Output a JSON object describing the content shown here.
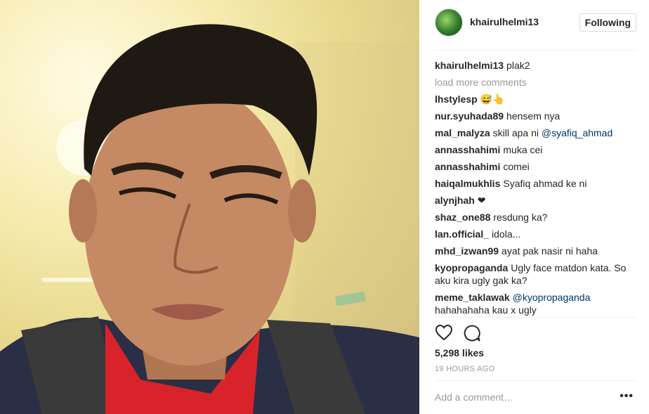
{
  "photo": {
    "alt_subject": "selfie-photo"
  },
  "post": {
    "username": "khairulhelmi13",
    "follow_label": "Following",
    "caption_user": "khairulhelmi13",
    "caption_text": "plak2",
    "load_more": "load more comments",
    "comments": [
      {
        "user": "lhstylesp",
        "text": "😅👆",
        "mention": ""
      },
      {
        "user": "nur.syuhada89",
        "text": "hensem nya",
        "mention": ""
      },
      {
        "user": "mal_malyza",
        "text": "skill apa ni",
        "mention": "@syafiq_ahmad"
      },
      {
        "user": "annasshahimi",
        "text": "muka cei",
        "mention": ""
      },
      {
        "user": "annasshahimi",
        "text": "comei",
        "mention": ""
      },
      {
        "user": "haiqalmukhlis",
        "text": "Syafiq ahmad ke ni",
        "mention": ""
      },
      {
        "user": "alynjhah",
        "text": "❤",
        "mention": ""
      },
      {
        "user": "shaz_one88",
        "text": "resdung ka?",
        "mention": ""
      },
      {
        "user": "lan.official_",
        "text": "idola...",
        "mention": ""
      },
      {
        "user": "mhd_izwan99",
        "text": "ayat pak nasir ni haha",
        "mention": ""
      },
      {
        "user": "kyopropaganda",
        "text": "Ugly face matdon kata. So aku kira ugly gak ka?",
        "mention": ""
      },
      {
        "user": "meme_taklawak",
        "text": "hahahahaha kau x ugly",
        "mention": "@kyopropaganda"
      }
    ],
    "likes": "5,298 likes",
    "timestamp": "19 HOURS AGO",
    "comment_placeholder": "Add a comment…",
    "more_label": "•••"
  },
  "icons": {
    "like": "heart-icon",
    "comment": "comment-bubble-icon",
    "more": "more-options-icon"
  },
  "colors": {
    "mention": "#003569",
    "muted": "#999999",
    "text": "#262626"
  }
}
